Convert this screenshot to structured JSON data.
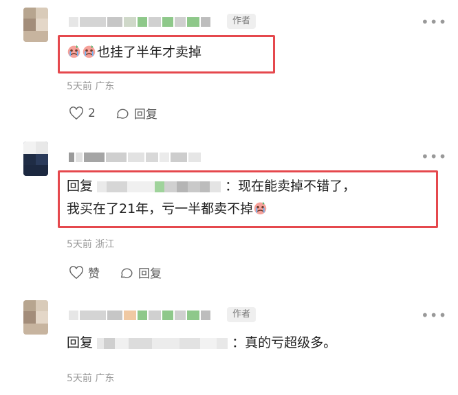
{
  "comments": [
    {
      "author_badge": "作者",
      "more_icon": "more-horizontal-icon",
      "emoji_icon": "crying-face-emoji",
      "text": "也挂了半年才卖掉",
      "time": "5天前",
      "location": "广东",
      "like_count": "2",
      "reply_label": "回复"
    },
    {
      "more_icon": "more-horizontal-icon",
      "reply_prefix": "回复",
      "text_line1_suffix": "：现在能卖掉不错了，",
      "text_line2": "我买在了21年，亏一半都卖不掉",
      "emoji_icon": "crying-face-emoji",
      "time": "5天前",
      "location": "浙江",
      "like_label": "赞",
      "reply_label": "回复"
    },
    {
      "author_badge": "作者",
      "more_icon": "more-horizontal-icon",
      "reply_prefix": "回复",
      "text_suffix": "：真的亏超级多。",
      "time": "5天前",
      "location": "广东"
    }
  ],
  "colors": {
    "highlight": "#e5484d",
    "meta": "#9a9a9a",
    "badge_bg": "#efefef"
  }
}
